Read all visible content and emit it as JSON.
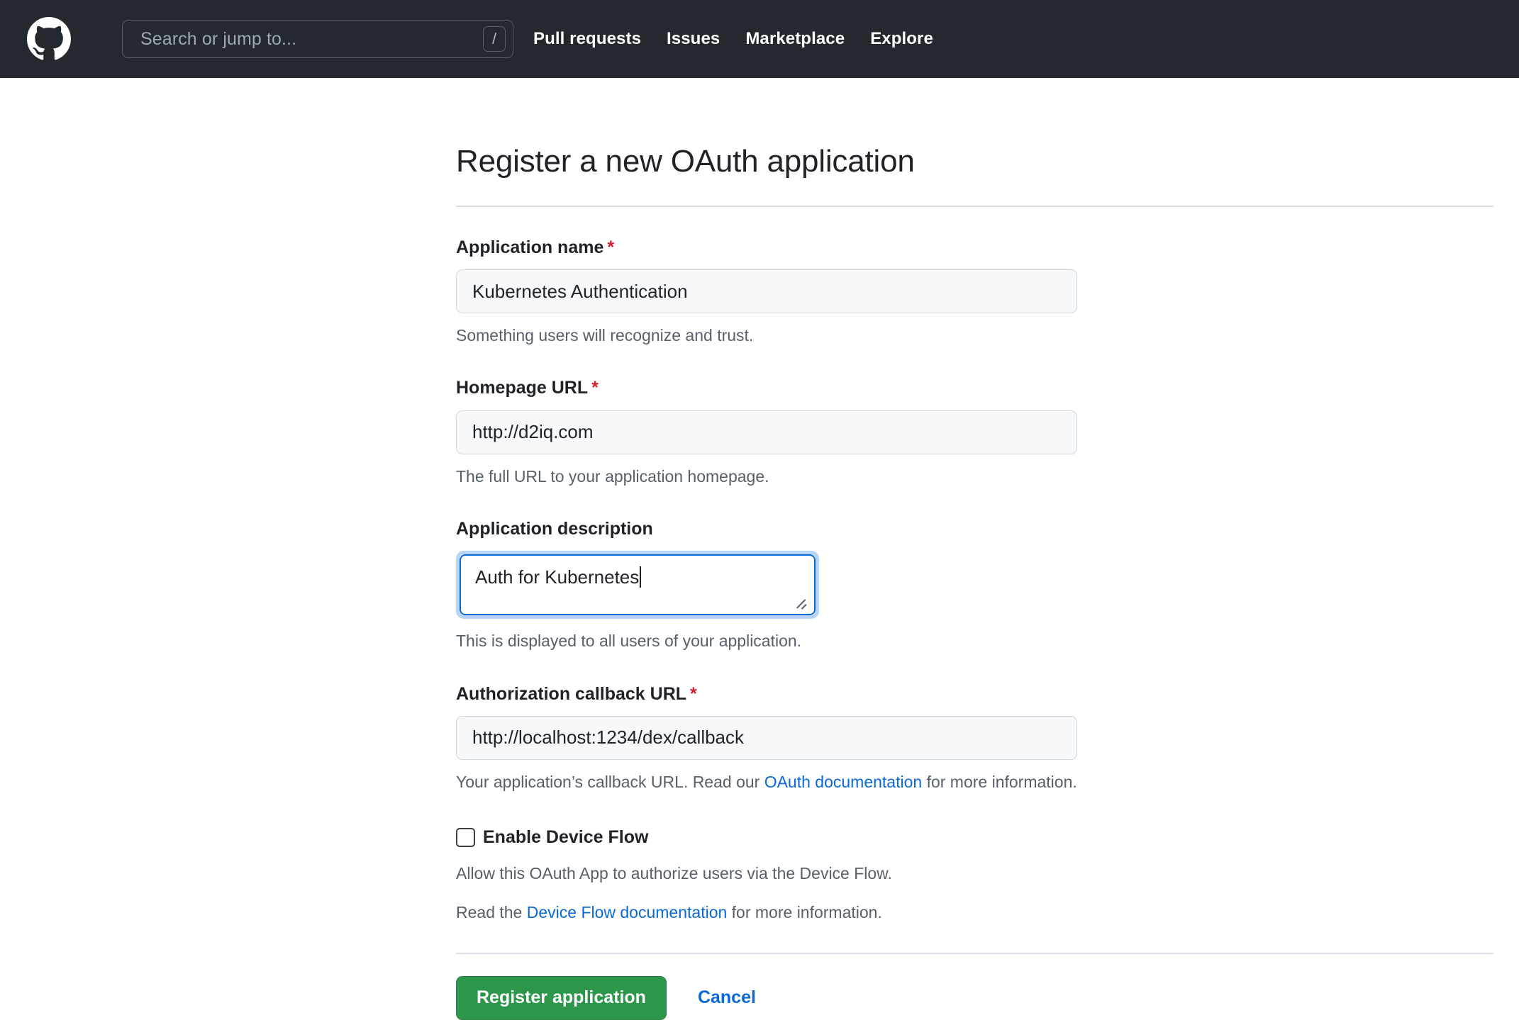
{
  "header": {
    "logo_icon": "github-mark-icon",
    "search": {
      "placeholder": "Search or jump to...",
      "value": "",
      "shortcut_key": "/"
    },
    "nav": [
      {
        "label": "Pull requests"
      },
      {
        "label": "Issues"
      },
      {
        "label": "Marketplace"
      },
      {
        "label": "Explore"
      }
    ],
    "background_color": "#24292f"
  },
  "main": {
    "title": "Register a new OAuth application",
    "required_marker": "*",
    "fields": {
      "app_name": {
        "label": "Application name",
        "required": true,
        "value": "Kubernetes Authentication",
        "placeholder": "",
        "hint": "Something users will recognize and trust."
      },
      "homepage_url": {
        "label": "Homepage URL",
        "required": true,
        "value": "http://d2iq.com",
        "placeholder": "",
        "hint": "The full URL to your application homepage."
      },
      "app_description": {
        "label": "Application description",
        "required": false,
        "value": "Auth for Kubernetes",
        "placeholder": "",
        "hint": "This is displayed to all users of your application.",
        "focused": true
      },
      "callback_url": {
        "label": "Authorization callback URL",
        "required": true,
        "value": "http://localhost:1234/dex/callback",
        "placeholder": "",
        "hint_before": "Your application’s callback URL. Read our ",
        "hint_link": "OAuth documentation",
        "hint_after": " for more information."
      }
    },
    "device_flow": {
      "checkbox_label": "Enable Device Flow",
      "checked": false,
      "description": "Allow this OAuth App to authorize users via the Device Flow.",
      "read_before": "Read the ",
      "read_link": "Device Flow documentation",
      "read_after": " for more information."
    },
    "actions": {
      "submit_label": "Register application",
      "cancel_label": "Cancel"
    }
  },
  "colors": {
    "header_bg": "#24292f",
    "accent_link": "#0969da",
    "primary_button": "#2c974b",
    "required_red": "#cf222e",
    "input_bg": "#f6f8fa",
    "border": "#d0d7de",
    "focus_border": "#0969da"
  }
}
